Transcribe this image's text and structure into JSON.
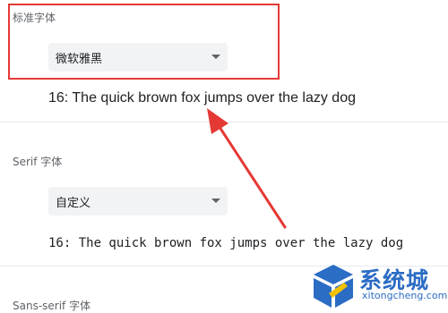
{
  "sections": {
    "standard": {
      "label": "标准字体",
      "selected_value": "微软雅黑",
      "sample_text": "16: The quick brown fox jumps over the lazy dog"
    },
    "serif": {
      "label": "Serif 字体",
      "selected_value": "自定义",
      "sample_text": "16: The quick brown fox jumps over the lazy dog"
    },
    "sans_serif": {
      "label": "Sans-serif 字体"
    }
  },
  "annotation": {
    "color": "#e53935"
  },
  "watermark": {
    "brand": "系统城",
    "url": "xitongcheng.com",
    "color": "#2b6cc4"
  }
}
